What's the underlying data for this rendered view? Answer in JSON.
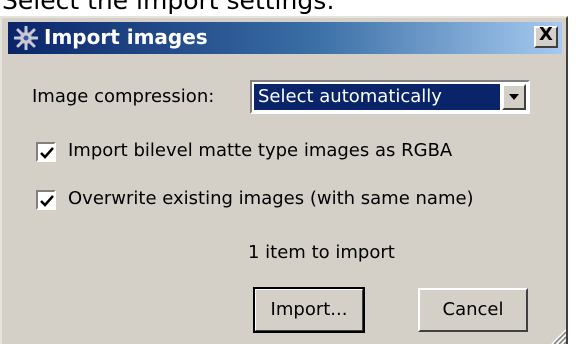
{
  "caption": "Select the import settings:",
  "dialog": {
    "title": "Import images",
    "close_label": "X"
  },
  "compression": {
    "label": "Image compression:",
    "selected": "Select automatically"
  },
  "options": [
    {
      "label": "Import bilevel matte type images as RGBA",
      "checked": true
    },
    {
      "label": "Overwrite existing images (with same name)",
      "checked": true
    }
  ],
  "status": "1 item to import",
  "buttons": {
    "import_label": "Import...",
    "cancel_label": "Cancel"
  },
  "icons": {
    "title": "gear-icon",
    "close": "close-icon",
    "dropdown": "chevron-down-icon",
    "check": "check-icon",
    "grip": "resize-grip-icon"
  },
  "colors": {
    "titlebar_start": "#0a246a",
    "titlebar_end": "#a6caf0",
    "dialog_face": "#d4d0c8",
    "selection": "#0a246a"
  }
}
